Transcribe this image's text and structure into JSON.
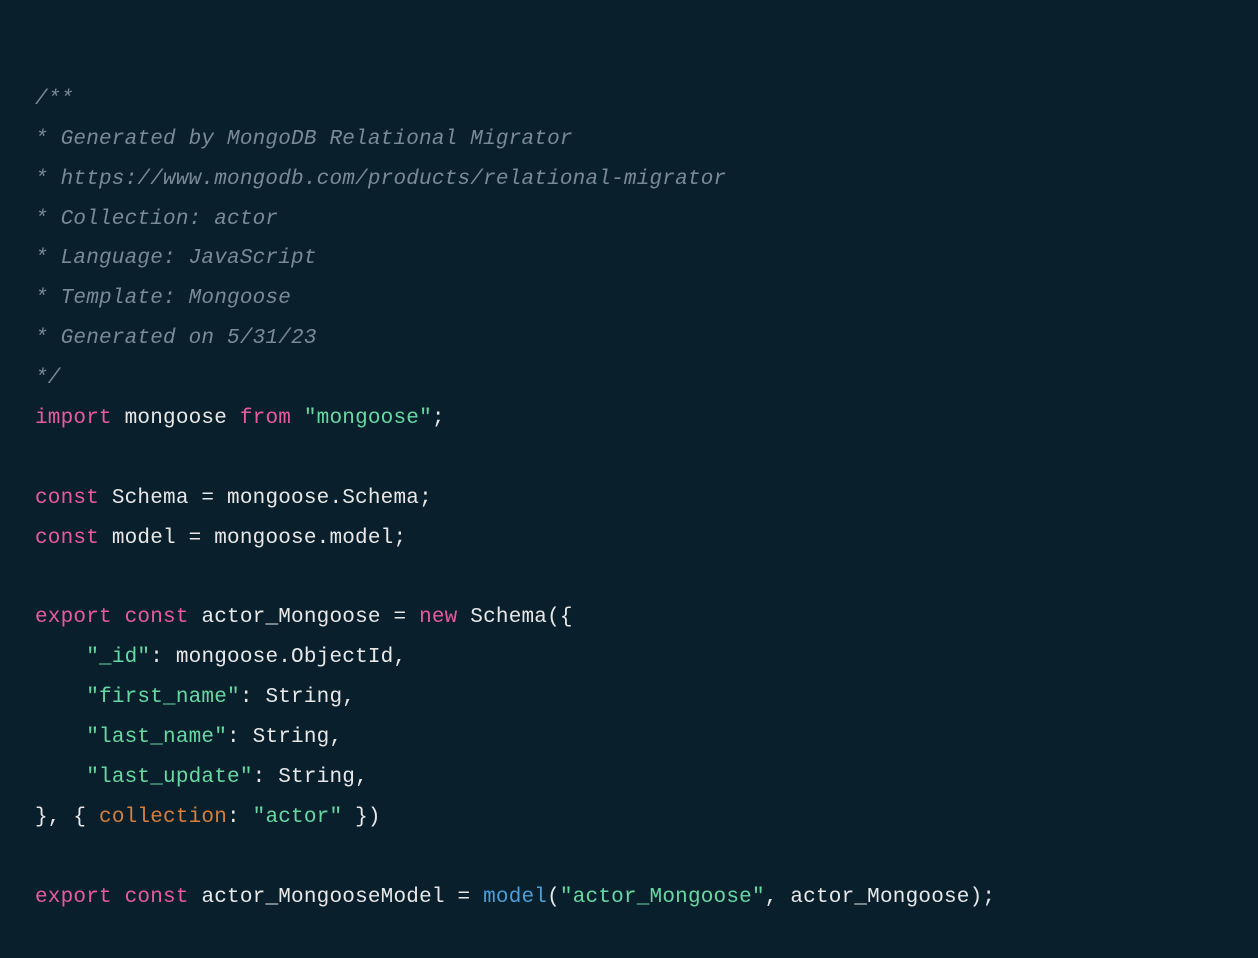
{
  "code": {
    "c1": "/**",
    "c2": "* Generated by MongoDB Relational Migrator",
    "c3": "* https://www.mongodb.com/products/relational-migrator",
    "c4": "* Collection: actor",
    "c5": "* Language: JavaScript",
    "c6": "* Template: Mongoose",
    "c7": "* Generated on 5/31/23",
    "c8": "*/",
    "kw_import": "import",
    "mongoose": " mongoose ",
    "kw_from": "from",
    "sp1": " ",
    "str_mongoose": "\"mongoose\"",
    "semi1": ";",
    "blank1": "",
    "kw_const1": "const",
    "schema_assign": " Schema = mongoose.Schema;",
    "kw_const2": "const",
    "model_assign": " model = mongoose.model;",
    "blank2": "",
    "kw_export1": "export",
    "sp2": " ",
    "kw_const3": "const",
    "actor_mongoose": " actor_Mongoose = ",
    "kw_new": "new",
    "schema_call": " Schema({",
    "indent1": "    ",
    "str_id": "\"_id\"",
    "id_val": ": mongoose.ObjectId,",
    "indent2": "    ",
    "str_fname": "\"first_name\"",
    "fname_val": ": String,",
    "indent3": "    ",
    "str_lname": "\"last_name\"",
    "lname_val": ": String,",
    "indent4": "    ",
    "str_lupdate": "\"last_update\"",
    "lupdate_val": ": String,",
    "close1": "}, { ",
    "prop_collection": "collection",
    "colon1": ": ",
    "str_actor": "\"actor\"",
    "close2": " })",
    "blank3": "",
    "kw_export2": "export",
    "sp3": " ",
    "kw_const4": "const",
    "model_name": " actor_MongooseModel = ",
    "fn_model": "model",
    "paren_open": "(",
    "str_actor_mongoose": "\"actor_Mongoose\"",
    "model_args": ", actor_Mongoose);"
  }
}
